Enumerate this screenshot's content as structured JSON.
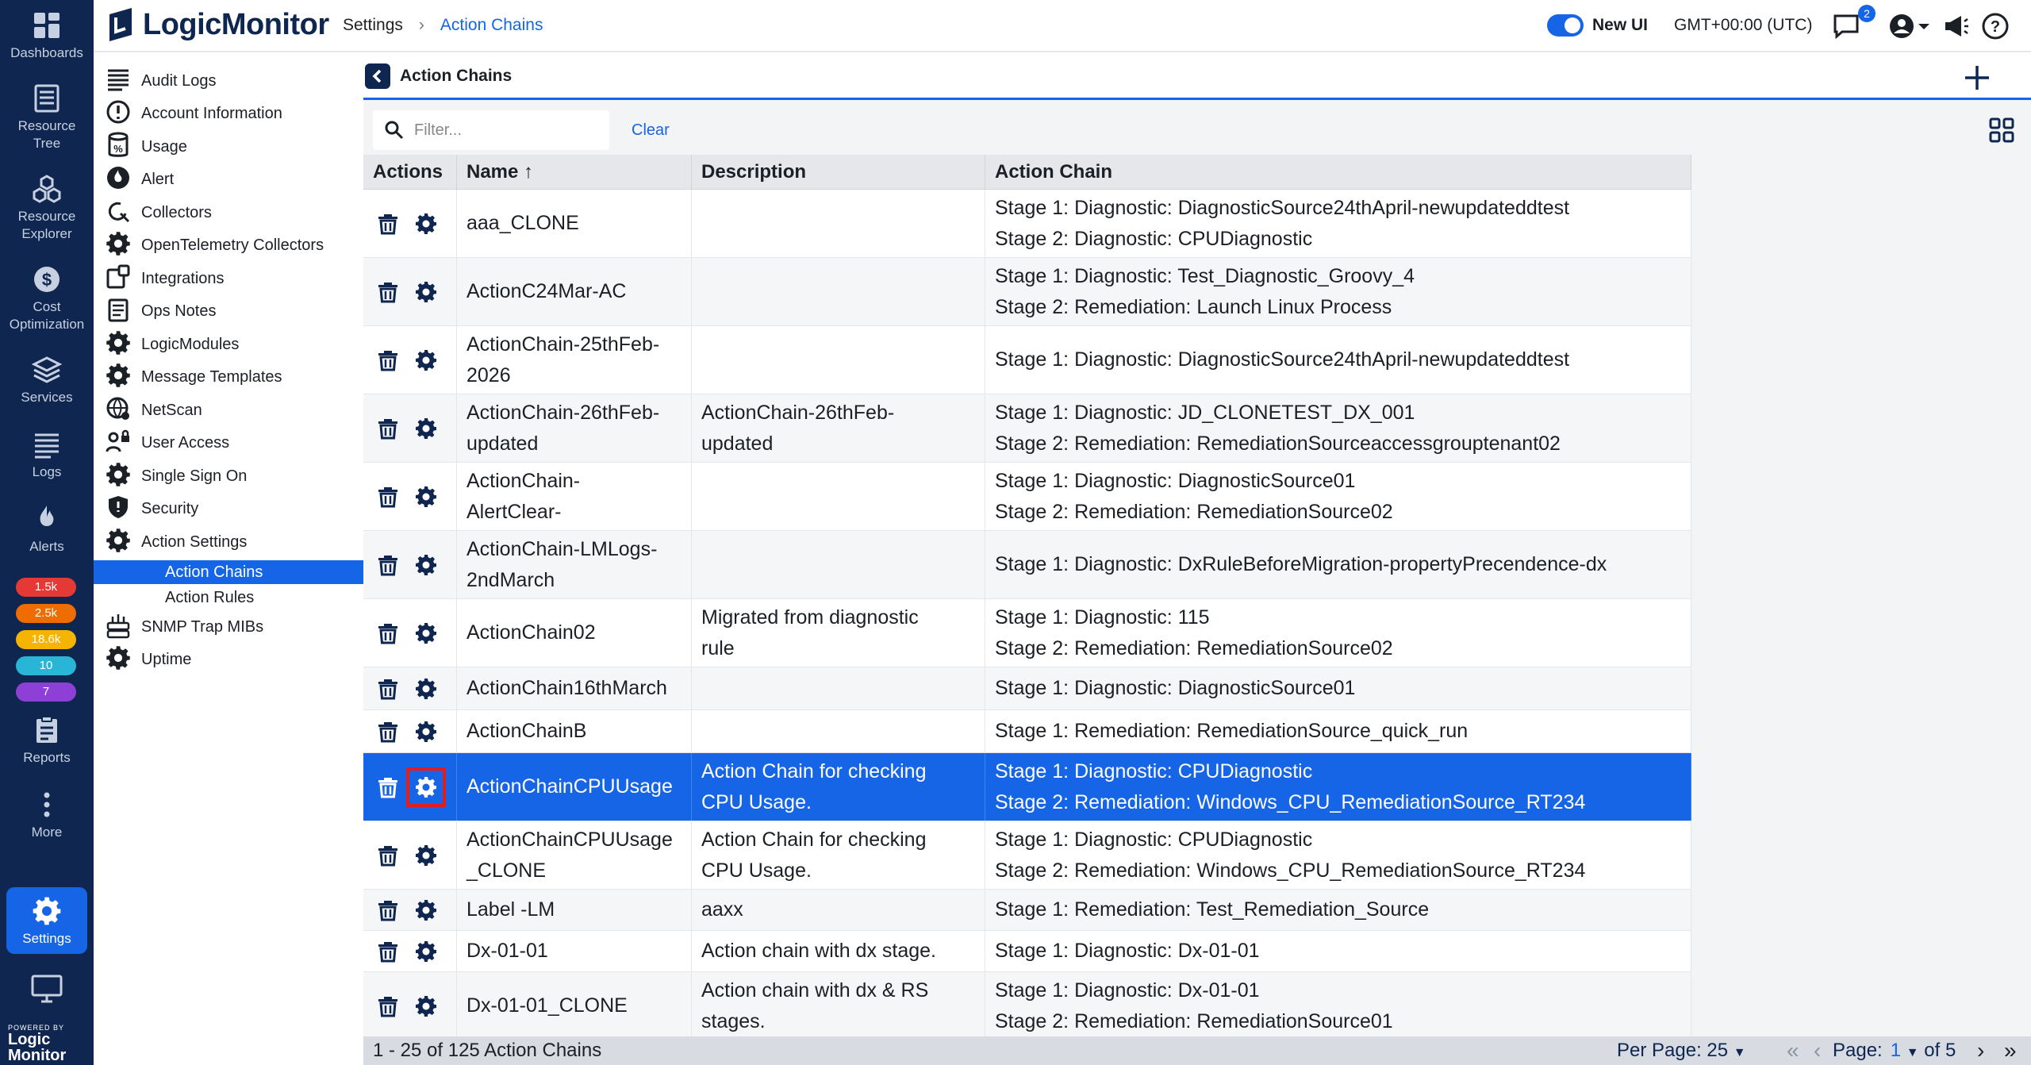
{
  "rail": {
    "items": [
      {
        "label": "Dashboards"
      },
      {
        "label": "Resource Tree"
      },
      {
        "label": "Resource Explorer"
      },
      {
        "label": "Cost Optimization"
      },
      {
        "label": "Services"
      },
      {
        "label": "Logs"
      },
      {
        "label": "Alerts"
      },
      {
        "label": "Reports"
      },
      {
        "label": "More"
      },
      {
        "label": "Settings"
      }
    ],
    "badges": [
      {
        "value": "1.5k",
        "color": "#e53935"
      },
      {
        "value": "2.5k",
        "color": "#ef6c00"
      },
      {
        "value": "18.6k",
        "color": "#f4b400"
      },
      {
        "value": "10",
        "color": "#29b6d6"
      },
      {
        "value": "7",
        "color": "#8e3fd6"
      }
    ],
    "logo_powered": "POWERED BY",
    "logo_line1": "Logic",
    "logo_line2": "Monitor"
  },
  "topbar": {
    "brand": "LogicMonitor",
    "breadcrumb": [
      "Settings",
      "Action Chains"
    ],
    "new_ui_label": "New UI",
    "timezone": "GMT+00:00 (UTC)",
    "notification_count": "2"
  },
  "sidebar": {
    "items": [
      {
        "label": "Audit Logs",
        "icon": "list-icon"
      },
      {
        "label": "Account Information",
        "icon": "info-icon"
      },
      {
        "label": "Usage",
        "icon": "usage-icon"
      },
      {
        "label": "Alert",
        "icon": "alert-icon"
      },
      {
        "label": "Collectors",
        "icon": "collector-icon"
      },
      {
        "label": "OpenTelemetry Collectors",
        "icon": "gear-icon"
      },
      {
        "label": "Integrations",
        "icon": "integrations-icon"
      },
      {
        "label": "Ops Notes",
        "icon": "notes-icon"
      },
      {
        "label": "LogicModules",
        "icon": "gear-icon"
      },
      {
        "label": "Message Templates",
        "icon": "gear-icon"
      },
      {
        "label": "NetScan",
        "icon": "globe-icon"
      },
      {
        "label": "User Access",
        "icon": "user-lock-icon"
      },
      {
        "label": "Single Sign On",
        "icon": "gear-icon"
      },
      {
        "label": "Security",
        "icon": "shield-icon"
      },
      {
        "label": "Action Settings",
        "icon": "gear-icon"
      }
    ],
    "sub_items": [
      {
        "label": "Action Chains"
      },
      {
        "label": "Action Rules"
      }
    ],
    "after_items": [
      {
        "label": "SNMP Trap MIBs",
        "icon": "snmp-icon"
      },
      {
        "label": "Uptime",
        "icon": "gear-icon"
      }
    ]
  },
  "main": {
    "title": "Action Chains",
    "filter_placeholder": "Filter...",
    "clear_label": "Clear",
    "columns": [
      "Actions",
      "Name",
      "Description",
      "Action Chain"
    ],
    "sort_glyph": "↑",
    "rows": [
      {
        "name": [
          "aaa_CLONE"
        ],
        "desc": [],
        "chain": [
          "Stage 1: Diagnostic: DiagnosticSource24thApril-newupdateddtest",
          "Stage 2: Diagnostic: CPUDiagnostic"
        ]
      },
      {
        "name": [
          "ActionC24Mar-AC"
        ],
        "desc": [],
        "chain": [
          "Stage 1: Diagnostic: Test_Diagnostic_Groovy_4",
          "Stage 2: Remediation: Launch Linux Process"
        ]
      },
      {
        "name": [
          "ActionChain-25thFeb-",
          "2026"
        ],
        "desc": [],
        "chain": [
          "Stage 1: Diagnostic: DiagnosticSource24thApril-newupdateddtest"
        ]
      },
      {
        "name": [
          "ActionChain-26thFeb-",
          "updated"
        ],
        "desc": [
          "ActionChain-26thFeb-",
          "updated"
        ],
        "chain": [
          "Stage 1: Diagnostic: JD_CLONETEST_DX_001",
          "Stage 2: Remediation: RemediationSourceaccessgrouptenant02"
        ]
      },
      {
        "name": [
          "ActionChain-",
          "AlertClear-"
        ],
        "desc": [],
        "chain": [
          "Stage 1: Diagnostic: DiagnosticSource01",
          "Stage 2: Remediation: RemediationSource02"
        ]
      },
      {
        "name": [
          "ActionChain-LMLogs-",
          "2ndMarch"
        ],
        "desc": [],
        "chain": [
          "Stage 1: Diagnostic: DxRuleBeforeMigration-propertyPrecendence-dx"
        ]
      },
      {
        "name": [
          "ActionChain02"
        ],
        "desc": [
          "Migrated from diagnostic",
          "rule"
        ],
        "chain": [
          "Stage 1: Diagnostic: 115",
          "Stage 2: Remediation: RemediationSource02"
        ]
      },
      {
        "name": [
          "ActionChain16thMarch"
        ],
        "desc": [],
        "chain": [
          "Stage 1: Diagnostic: DiagnosticSource01"
        ]
      },
      {
        "name": [
          "ActionChainB"
        ],
        "desc": [],
        "chain": [
          "Stage 1: Remediation: RemediationSource_quick_run"
        ]
      },
      {
        "name": [
          "ActionChainCPUUsage"
        ],
        "desc": [
          "Action Chain for checking",
          "CPU Usage."
        ],
        "chain": [
          "Stage 1: Diagnostic: CPUDiagnostic",
          "Stage 2: Remediation: Windows_CPU_RemediationSource_RT234"
        ],
        "selected": true
      },
      {
        "name": [
          "ActionChainCPUUsage",
          "_CLONE"
        ],
        "desc": [
          "Action Chain for checking",
          "CPU Usage."
        ],
        "chain": [
          "Stage 1: Diagnostic: CPUDiagnostic",
          "Stage 2: Remediation: Windows_CPU_RemediationSource_RT234"
        ]
      },
      {
        "name": [
          "Label -LM"
        ],
        "desc": [
          "aaxx"
        ],
        "chain": [
          "Stage 1: Remediation: Test_Remediation_Source"
        ]
      },
      {
        "name": [
          "Dx-01-01"
        ],
        "desc": [
          "Action chain with dx stage."
        ],
        "chain": [
          "Stage 1: Diagnostic: Dx-01-01"
        ]
      },
      {
        "name": [
          "Dx-01-01_CLONE"
        ],
        "desc": [
          "Action chain with dx & RS",
          "stages."
        ],
        "chain": [
          "Stage 1: Diagnostic: Dx-01-01",
          "Stage 2: Remediation: RemediationSource01"
        ]
      }
    ]
  },
  "footer": {
    "count_text": "1 - 25 of 125 Action Chains",
    "per_page_label": "Per Page:",
    "per_page_value": "25",
    "page_label": "Page:",
    "page_current": "1",
    "page_of": "of 5"
  },
  "colors": {
    "accent": "#1565e6",
    "rail_bg": "#0f2650",
    "highlight": "#e01e1e"
  }
}
